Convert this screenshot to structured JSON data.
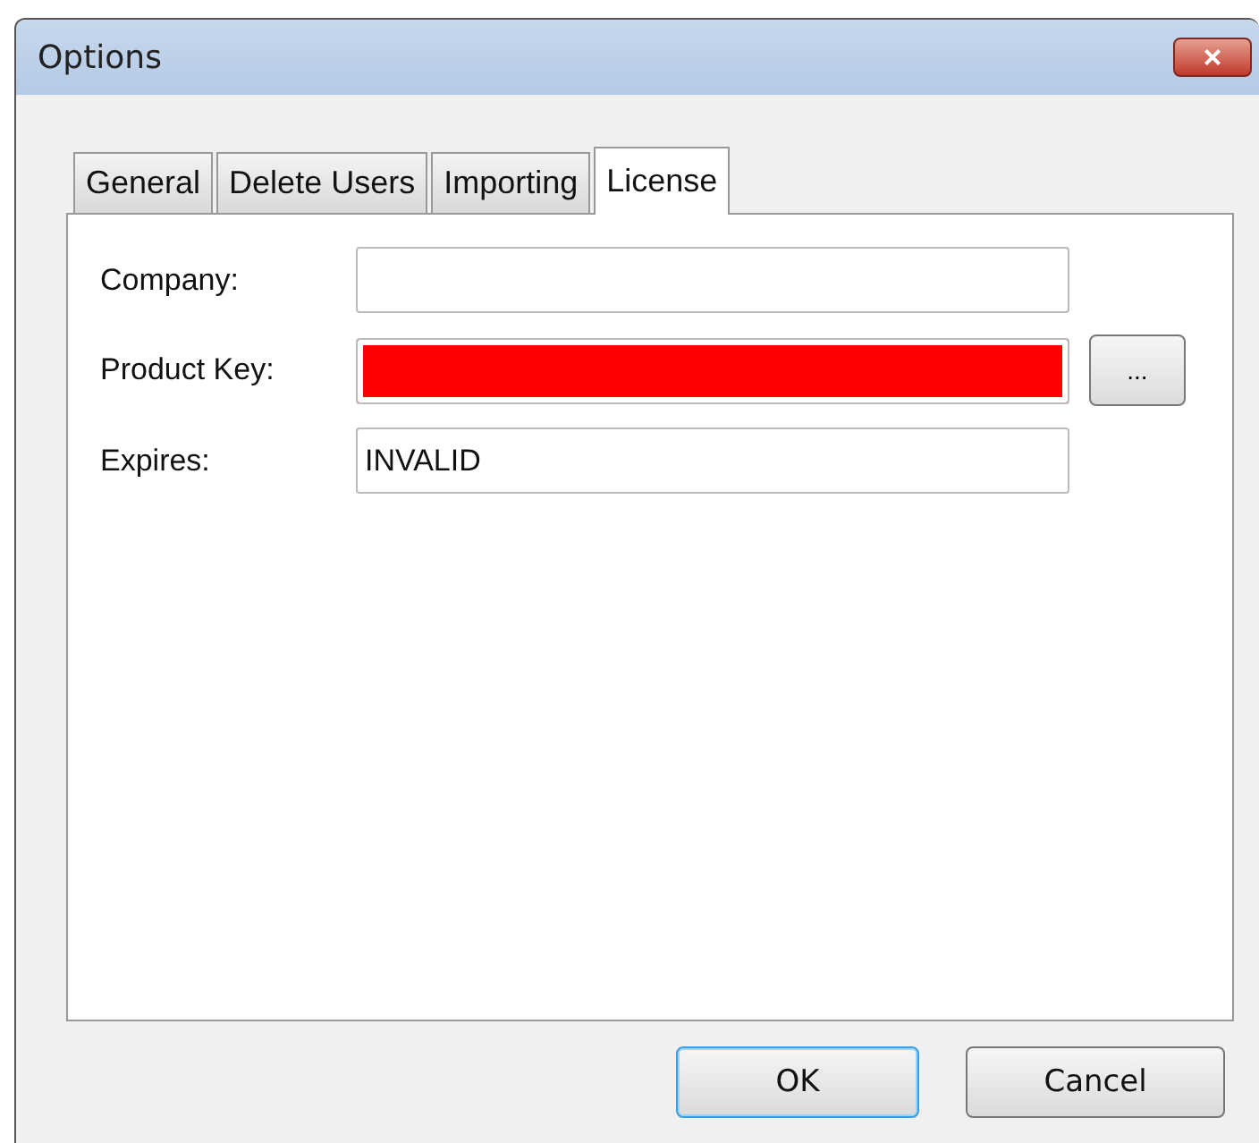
{
  "window": {
    "title": "Options",
    "close": "×"
  },
  "tabs": [
    {
      "label": "General",
      "selected": false
    },
    {
      "label": "Delete Users",
      "selected": false
    },
    {
      "label": "Importing",
      "selected": false
    },
    {
      "label": "License",
      "selected": true
    }
  ],
  "fields": [
    {
      "label": "Company:",
      "error": false
    },
    {
      "label": "Product Key:",
      "error": true,
      "browse": "..."
    },
    {
      "label": "Expires:",
      "value": "INVALID",
      "error": false
    }
  ],
  "buttons": [
    {
      "label": "OK",
      "default": true
    },
    {
      "label": "Cancel",
      "default": false
    }
  ]
}
